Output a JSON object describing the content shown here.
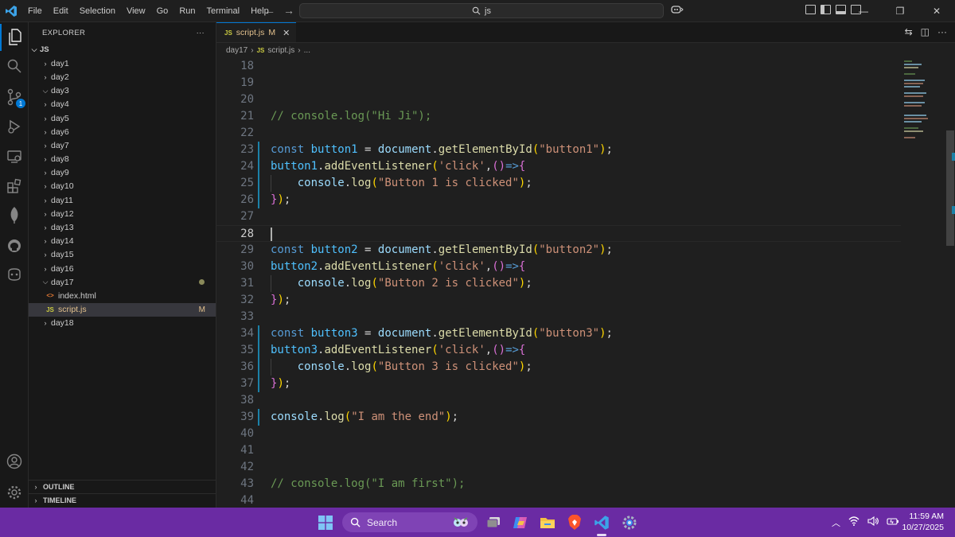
{
  "menu": [
    "File",
    "Edit",
    "Selection",
    "View",
    "Go",
    "Run",
    "Terminal",
    "Help"
  ],
  "command_center": "js",
  "explorer": {
    "title": "EXPLORER",
    "root": "JS",
    "items": [
      "day1",
      "day2",
      "day3",
      "day4",
      "day5",
      "day6",
      "day7",
      "day8",
      "day9",
      "day10",
      "day11",
      "day12",
      "day13",
      "day14",
      "day15",
      "day16",
      "day17",
      "index.html",
      "script.js",
      "day18"
    ],
    "modified_marker": "M",
    "outline": "OUTLINE",
    "timeline": "TIMELINE"
  },
  "source_control_badge": "1",
  "tab": {
    "icon": "JS",
    "label": "script.js",
    "status": "M"
  },
  "breadcrumb": {
    "folder": "day17",
    "icon": "JS",
    "file": "script.js",
    "more": "..."
  },
  "editor": {
    "line_numbers": [
      "18",
      "19",
      "20",
      "21",
      "22",
      "23",
      "24",
      "25",
      "26",
      "27",
      "28",
      "29",
      "30",
      "31",
      "32",
      "33",
      "34",
      "35",
      "36",
      "37",
      "38",
      "39",
      "40",
      "41",
      "42",
      "43",
      "44"
    ],
    "current_line": "28"
  },
  "taskbar": {
    "search_label": "Search",
    "time": "11:59 AM",
    "date": "10/27/2025"
  },
  "colors": {
    "accent": "#0078d4",
    "taskbar": "#6a2ba3",
    "comment": "#6a9955",
    "string": "#ce9178",
    "keyword": "#569cd6"
  }
}
